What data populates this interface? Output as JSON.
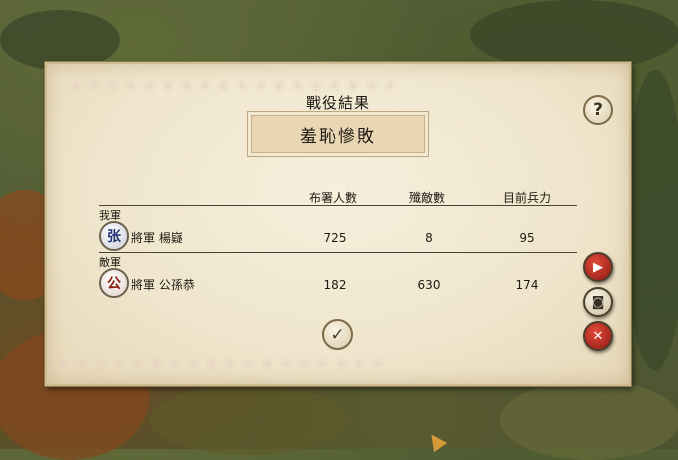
{
  "dialog": {
    "title": "戰役結果",
    "result": "羞恥慘敗",
    "help_label": "?"
  },
  "table": {
    "headers": [
      "布署人數",
      "殲敵數",
      "目前兵力"
    ],
    "ally": {
      "label": "我軍",
      "icon_char": "张",
      "general": "將軍 楊嶷",
      "deployed": "725",
      "kills": "8",
      "current": "95"
    },
    "enemy": {
      "label": "敵軍",
      "icon_char": "公",
      "general": "將軍 公孫恭",
      "deployed": "182",
      "kills": "630",
      "current": "174"
    }
  },
  "buttons": {
    "confirm_glyph": "✓",
    "side": [
      {
        "name": "battle-replay",
        "glyph": "▶",
        "color": "#b8261b"
      },
      {
        "name": "camera",
        "glyph": "◙",
        "color": "#e9e2cf"
      },
      {
        "name": "close",
        "glyph": "✕",
        "color": "#b8261b"
      }
    ]
  }
}
